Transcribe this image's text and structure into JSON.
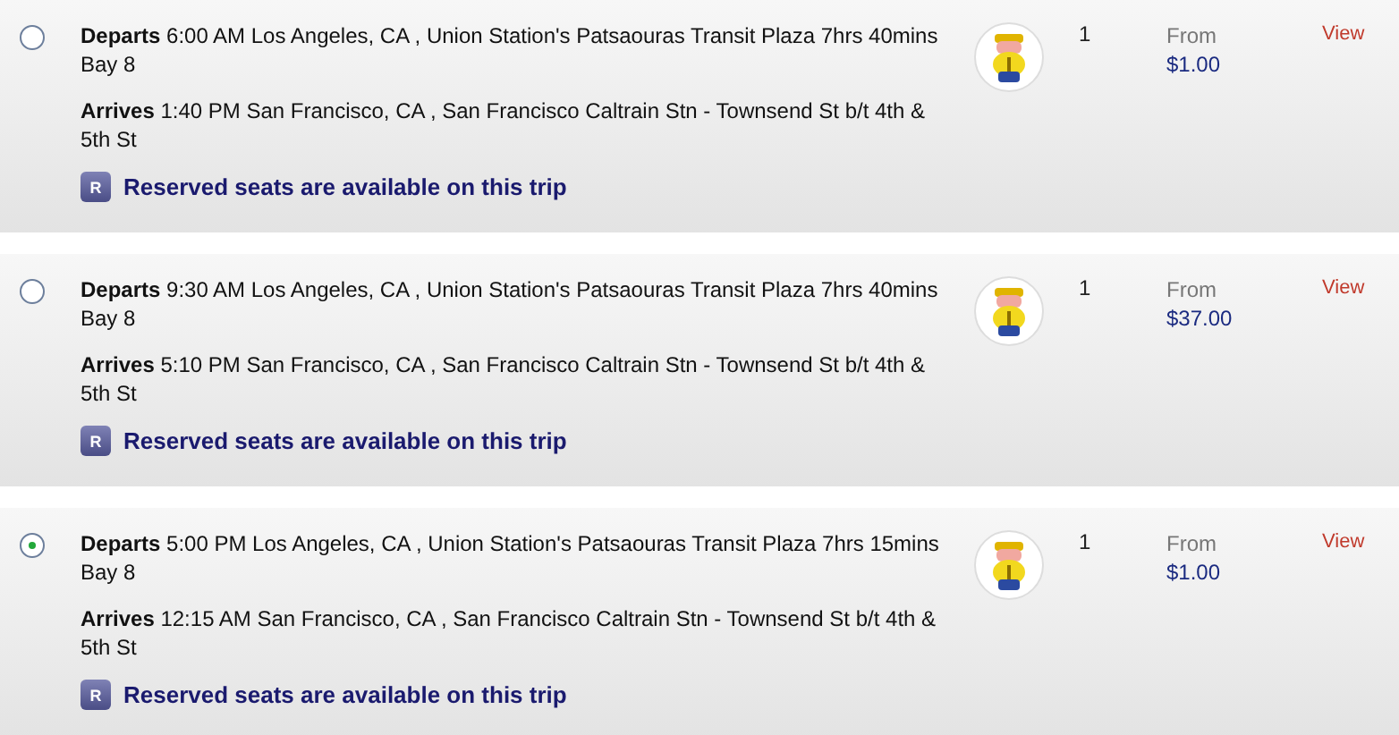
{
  "trips": [
    {
      "selected": false,
      "departs": "**Departs** 6:00 AM Los Angeles, CA , Union Station's Patsaouras Transit Plaza 7hrs 40mins Bay 8",
      "arrives": "**Arrives** 1:40 PM San Francisco, CA , San Francisco Caltrain Stn - Townsend St b/t 4th & 5th St",
      "badge": "R",
      "notice": "Reserved seats are available on this trip",
      "count": "1",
      "from": "From",
      "price": "$1.00",
      "link": "View"
    },
    {
      "selected": false,
      "departs": "**Departs** 9:30 AM Los Angeles, CA , Union Station's Patsaouras Transit Plaza 7hrs 40mins Bay 8",
      "arrives": "**Arrives** 5:10 PM San Francisco, CA , San Francisco Caltrain Stn - Townsend St b/t 4th & 5th St",
      "badge": "R",
      "notice": "Reserved seats are available on this trip",
      "count": "1",
      "from": "From",
      "price": "$37.00",
      "link": "View"
    },
    {
      "selected": true,
      "departs": "**Departs** 5:00 PM Los Angeles, CA , Union Station's Patsaouras Transit Plaza 7hrs 15mins Bay 8",
      "arrives": "**Arrives** 12:15 AM San Francisco, CA , San Francisco Caltrain Stn - Townsend St b/t 4th & 5th St",
      "badge": "R",
      "notice": "Reserved seats are available on this trip",
      "count": "1",
      "from": "From",
      "price": "$1.00",
      "link": "View"
    }
  ]
}
